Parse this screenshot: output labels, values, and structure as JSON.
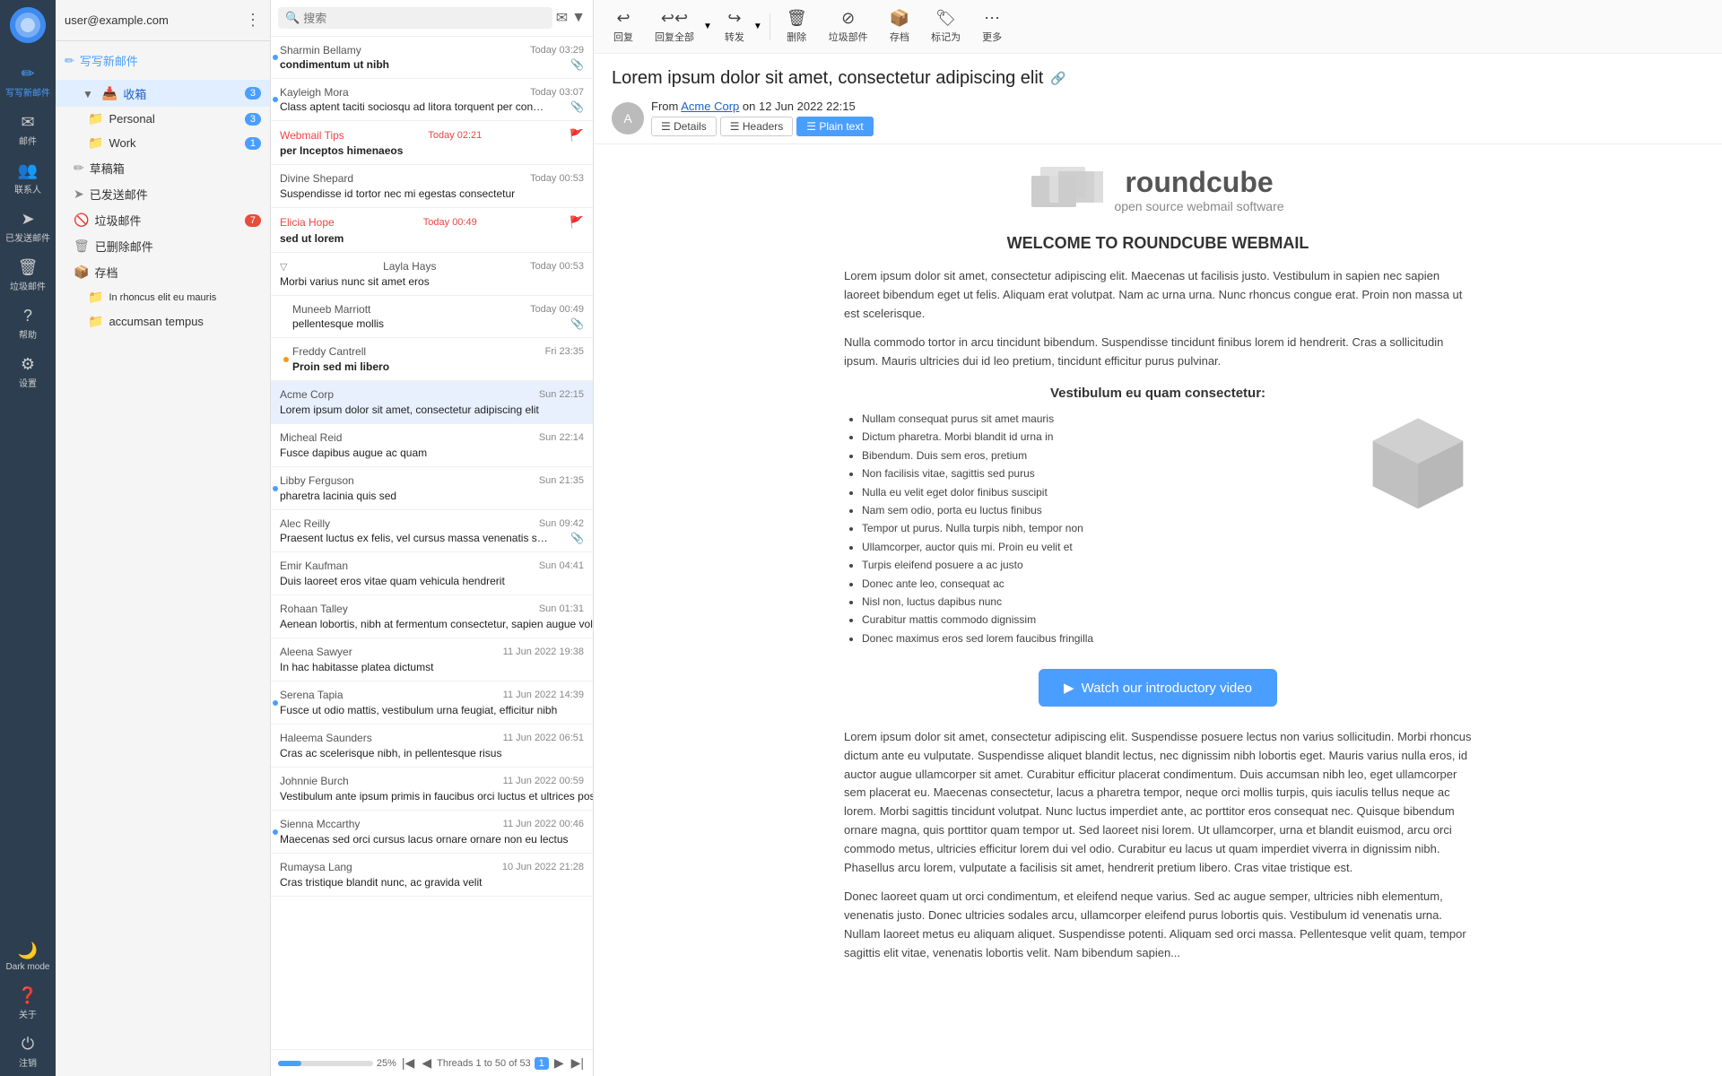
{
  "sidebar": {
    "logo": "R",
    "account": "user@example.com",
    "items": [
      {
        "id": "compose",
        "icon": "✏",
        "label": "写写新邮件",
        "active": true
      },
      {
        "id": "mail",
        "icon": "✉",
        "label": "邮件"
      },
      {
        "id": "contacts",
        "icon": "👥",
        "label": "联系人"
      },
      {
        "id": "sent",
        "icon": "➤",
        "label": "已发送邮件"
      },
      {
        "id": "trash",
        "icon": "🗑",
        "label": "垃圾邮件"
      },
      {
        "id": "help",
        "icon": "?",
        "label": "帮助"
      },
      {
        "id": "settings",
        "icon": "⚙",
        "label": "设置"
      }
    ],
    "bottom_items": [
      {
        "id": "darkmode",
        "icon": "🌙",
        "label": "Dark mode"
      },
      {
        "id": "about",
        "icon": "?",
        "label": "关于"
      },
      {
        "id": "logout",
        "icon": "⏻",
        "label": "注销"
      }
    ]
  },
  "folders": {
    "inbox_label": "收箱",
    "inbox_count": "3",
    "items": [
      {
        "id": "personal",
        "icon": "📁",
        "label": "Personal",
        "badge": "3",
        "indent": false
      },
      {
        "id": "work",
        "icon": "📁",
        "label": "Work",
        "badge": "1",
        "indent": false
      },
      {
        "id": "drafts",
        "icon": "✏",
        "label": "草稿箱",
        "badge": "",
        "indent": false
      },
      {
        "id": "sent_folder",
        "icon": "➤",
        "label": "已发送邮件",
        "badge": "",
        "indent": false
      },
      {
        "id": "junk",
        "icon": "🚫",
        "label": "垃圾邮件",
        "badge": "7",
        "indent": false
      },
      {
        "id": "deleted",
        "icon": "🗑",
        "label": "已删除邮件",
        "badge": "",
        "indent": false
      },
      {
        "id": "archive",
        "icon": "📦",
        "label": "存档",
        "badge": "",
        "indent": false
      },
      {
        "id": "rhoncus",
        "icon": "📁",
        "label": "In rhoncus elit eu mauris",
        "badge": "",
        "indent": true
      },
      {
        "id": "accumsan",
        "icon": "📁",
        "label": "accumsan tempus",
        "badge": "",
        "indent": true
      }
    ]
  },
  "search": {
    "placeholder": "搜索"
  },
  "email_list": {
    "emails": [
      {
        "id": "e1",
        "sender": "Sharmin Bellamy",
        "subject": "condimentum ut nibh",
        "date": "Today 03:29",
        "unread": true,
        "selected": false,
        "flag": false,
        "attachment": true,
        "indent": false,
        "dot": "blue",
        "sender_highlight": false,
        "date_highlight": false
      },
      {
        "id": "e2",
        "sender": "Kayleigh Mora",
        "subject": "Class aptent taciti sociosqu ad litora torquent per conubia nostra",
        "date": "Today 03:07",
        "unread": false,
        "selected": false,
        "flag": false,
        "attachment": true,
        "indent": false,
        "dot": "blue",
        "sender_highlight": false,
        "date_highlight": false
      },
      {
        "id": "e3",
        "sender": "Webmail Tips",
        "subject": "per Inceptos himenaeos",
        "date": "Today 02:21",
        "unread": true,
        "selected": false,
        "flag": true,
        "attachment": false,
        "indent": false,
        "dot": "none",
        "sender_highlight": true,
        "date_highlight": true
      },
      {
        "id": "e4",
        "sender": "Divine Shepard",
        "subject": "Suspendisse id tortor nec mi egestas consectetur",
        "date": "Today 00:53",
        "unread": false,
        "selected": false,
        "flag": false,
        "attachment": false,
        "indent": false,
        "dot": "none",
        "sender_highlight": false,
        "date_highlight": false
      },
      {
        "id": "e5",
        "sender": "Elicia Hope",
        "subject": "sed ut lorem",
        "date": "Today 00:49",
        "unread": true,
        "selected": false,
        "flag": true,
        "attachment": false,
        "indent": false,
        "dot": "none",
        "sender_highlight": true,
        "date_highlight": true
      },
      {
        "id": "e6",
        "sender": "Layla Hays",
        "subject": "Morbi varius nunc sit amet eros",
        "date": "Today 00:53",
        "unread": false,
        "selected": false,
        "flag": false,
        "attachment": false,
        "indent": false,
        "dot": "none",
        "sender_highlight": false,
        "date_highlight": false,
        "thread": true
      },
      {
        "id": "e7",
        "sender": "Muneeb Marriott",
        "subject": "pellentesque mollis",
        "date": "Today 00:49",
        "unread": false,
        "selected": false,
        "flag": false,
        "attachment": true,
        "indent": true,
        "dot": "none",
        "sender_highlight": false,
        "date_highlight": false
      },
      {
        "id": "e8",
        "sender": "Freddy Cantrell",
        "subject": "Proin sed mi libero",
        "date": "Fri 23:35",
        "unread": false,
        "selected": false,
        "flag": false,
        "attachment": false,
        "indent": true,
        "dot": "yellow",
        "sender_highlight": false,
        "date_highlight": false
      },
      {
        "id": "e9",
        "sender": "Acme Corp",
        "subject": "Lorem ipsum dolor sit amet, consectetur adipiscing elit",
        "date": "Sun 22:15",
        "unread": false,
        "selected": true,
        "flag": false,
        "attachment": false,
        "indent": false,
        "dot": "none",
        "sender_highlight": false,
        "date_highlight": false
      },
      {
        "id": "e10",
        "sender": "Micheal Reid",
        "subject": "Fusce dapibus augue ac quam",
        "date": "Sun 22:14",
        "unread": false,
        "selected": false,
        "flag": false,
        "attachment": false,
        "indent": false,
        "dot": "none",
        "sender_highlight": false,
        "date_highlight": false
      },
      {
        "id": "e11",
        "sender": "Libby Ferguson",
        "subject": "pharetra lacinia quis sed",
        "date": "Sun 21:35",
        "unread": false,
        "selected": false,
        "flag": false,
        "attachment": false,
        "indent": false,
        "dot": "blue",
        "sender_highlight": false,
        "date_highlight": false
      },
      {
        "id": "e12",
        "sender": "Alec Reilly",
        "subject": "Praesent luctus ex felis, vel cursus massa venenatis sit amet",
        "date": "Sun 09:42",
        "unread": false,
        "selected": false,
        "flag": false,
        "attachment": true,
        "indent": false,
        "dot": "none",
        "sender_highlight": false,
        "date_highlight": false
      },
      {
        "id": "e13",
        "sender": "Emir Kaufman",
        "subject": "Duis laoreet eros vitae quam vehicula hendrerit",
        "date": "Sun 04:41",
        "unread": false,
        "selected": false,
        "flag": false,
        "attachment": false,
        "indent": false,
        "dot": "none",
        "sender_highlight": false,
        "date_highlight": false
      },
      {
        "id": "e14",
        "sender": "Rohaan Talley",
        "subject": "Aenean lobortis, nibh at fermentum consectetur, sapien augue vol...",
        "date": "Sun 01:31",
        "unread": false,
        "selected": false,
        "flag": false,
        "attachment": false,
        "indent": false,
        "dot": "none",
        "sender_highlight": false,
        "date_highlight": false
      },
      {
        "id": "e15",
        "sender": "Aleena Sawyer",
        "subject": "In hac habitasse platea dictumst",
        "date": "11 Jun 2022 19:38",
        "unread": false,
        "selected": false,
        "flag": false,
        "attachment": false,
        "indent": false,
        "dot": "none",
        "sender_highlight": false,
        "date_highlight": false
      },
      {
        "id": "e16",
        "sender": "Serena Tapia",
        "subject": "Fusce ut odio mattis, vestibulum urna feugiat, efficitur nibh",
        "date": "11 Jun 2022 14:39",
        "unread": false,
        "selected": false,
        "flag": false,
        "attachment": false,
        "indent": false,
        "dot": "blue",
        "sender_highlight": false,
        "date_highlight": false
      },
      {
        "id": "e17",
        "sender": "Haleema Saunders",
        "subject": "Cras ac scelerisque nibh, in pellentesque risus",
        "date": "11 Jun 2022 06:51",
        "unread": false,
        "selected": false,
        "flag": false,
        "attachment": false,
        "indent": false,
        "dot": "none",
        "sender_highlight": false,
        "date_highlight": false
      },
      {
        "id": "e18",
        "sender": "Johnnie Burch",
        "subject": "Vestibulum ante ipsum primis in faucibus orci luctus et ultrices pos...",
        "date": "11 Jun 2022 00:59",
        "unread": false,
        "selected": false,
        "flag": false,
        "attachment": false,
        "indent": false,
        "dot": "none",
        "sender_highlight": false,
        "date_highlight": false
      },
      {
        "id": "e19",
        "sender": "Sienna Mccarthy",
        "subject": "Maecenas sed orci cursus lacus ornare ornare non eu lectus",
        "date": "11 Jun 2022 00:46",
        "unread": false,
        "selected": false,
        "flag": false,
        "attachment": false,
        "indent": false,
        "dot": "blue",
        "sender_highlight": false,
        "date_highlight": false
      },
      {
        "id": "e20",
        "sender": "Rumaysa Lang",
        "subject": "Cras tristique blandit nunc, ac gravida velit",
        "date": "10 Jun 2022 21:28",
        "unread": false,
        "selected": false,
        "flag": false,
        "attachment": false,
        "indent": false,
        "dot": "none",
        "sender_highlight": false,
        "date_highlight": false
      }
    ],
    "footer": {
      "threads_label": "Threads 1 to 50 of 53",
      "page": "1",
      "progress": 25
    }
  },
  "toolbar": {
    "reply_label": "回复",
    "reply_all_label": "回复全部",
    "forward_label": "转发",
    "delete_label": "删除",
    "junk_label": "垃圾部件",
    "archive_label": "存档",
    "mark_label": "标记为",
    "more_label": "更多"
  },
  "email_view": {
    "subject": "Lorem ipsum dolor sit amet, consectetur adipiscing elit",
    "from_label": "From",
    "sender": "Acme Corp",
    "date": "on 12 Jun 2022 22:15",
    "tabs": [
      {
        "id": "details",
        "label": "Details",
        "icon": "☰",
        "active": false
      },
      {
        "id": "headers",
        "label": "Headers",
        "icon": "☰",
        "active": false
      },
      {
        "id": "plain_text",
        "label": "Plain text",
        "icon": "☰",
        "active": true
      }
    ],
    "logo_text": "roundcube",
    "logo_sub": "open source webmail software",
    "welcome_title": "WELCOME TO ROUNDCUBE WEBMAIL",
    "body_para1": "Lorem ipsum dolor sit amet, consectetur adipiscing elit. Maecenas ut facilisis justo. Vestibulum in sapien nec sapien laoreet bibendum eget ut felis. Aliquam erat volutpat. Nam ac urna urna. Nunc rhoncus congue erat. Proin non massa ut est scelerisque.",
    "body_para2": "Nulla commodo tortor in arcu tincidunt bibendum. Suspendisse tincidunt finibus lorem id hendrerit. Cras a sollicitudin ipsum. Mauris ultricies dui id leo pretium, tincidunt efficitur purus pulvinar.",
    "vestibulum_title": "Vestibulum eu quam consectetur:",
    "list_items": [
      "Nullam consequat purus sit amet mauris",
      "Dictum pharetra. Morbi blandit id urna in",
      "Bibendum. Duis sem eros, pretium",
      "Non facilisis vitae, sagittis sed purus",
      "Nulla eu velit eget dolor finibus suscipit",
      "Nam sem odio, porta eu luctus finibus",
      "Tempor ut purus. Nulla turpis nibh, tempor non",
      "Ullamcorper, auctor quis mi. Proin eu velit et",
      "Turpis eleifend posuere a ac justo",
      "Donec ante leo, consequat ac",
      "Nisl non, luctus dapibus nunc",
      "Curabitur mattis commodo dignissim",
      "Donec maximus eros sed lorem faucibus fringilla"
    ],
    "watch_btn_label": "Watch our introductory video",
    "body_para3": "Lorem ipsum dolor sit amet, consectetur adipiscing elit. Suspendisse posuere lectus non varius sollicitudin. Morbi rhoncus dictum ante eu vulputate. Suspendisse aliquet blandit lectus, nec dignissim nibh lobortis eget. Mauris varius nulla eros, id auctor augue ullamcorper sit amet. Curabitur efficitur placerat condimentum. Duis accumsan nibh leo, eget ullamcorper sem placerat eu. Maecenas consectetur, lacus a pharetra tempor, neque orci mollis turpis, quis iaculis tellus neque ac lorem. Morbi sagittis tincidunt volutpat. Nunc luctus imperdiet ante, ac porttitor eros consequat nec. Quisque bibendum ornare magna, quis porttitor quam tempor ut. Sed laoreet nisi lorem. Ut ullamcorper, urna et blandit euismod, arcu orci commodo metus, ultricies efficitur lorem dui vel odio. Curabitur eu lacus ut quam imperdiet viverra in dignissim nibh. Phasellus arcu lorem, vulputate a facilisis sit amet, hendrerit pretium libero. Cras vitae tristique est.",
    "body_para4": "Donec laoreet quam ut orci condimentum, et eleifend neque varius. Sed ac augue semper, ultricies nibh elementum, venenatis justo. Donec ultricies sodales arcu, ullamcorper eleifend purus lobortis quis. Vestibulum id venenatis urna. Nullam laoreet metus eu aliquam aliquet. Suspendisse potenti. Aliquam sed orci massa. Pellentesque velit quam, tempor sagittis elit vitae, venenatis lobortis velit. Nam bibendum sapien..."
  }
}
